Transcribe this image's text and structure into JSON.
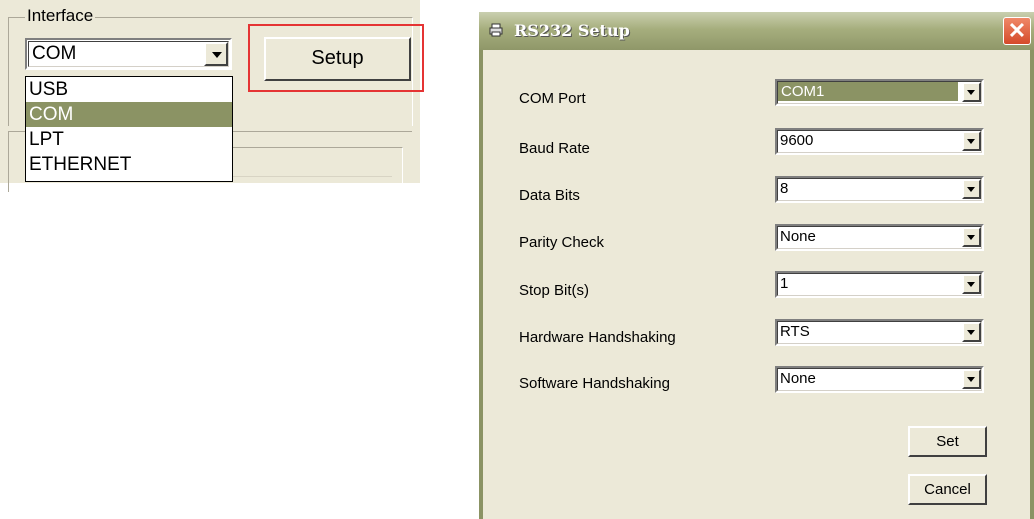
{
  "interface": {
    "group_title": "Interface",
    "combo_value": "COM",
    "options": [
      "USB",
      "COM",
      "LPT",
      "ETHERNET"
    ],
    "selected_option": "COM",
    "setup_label": "Setup",
    "highlight_color": "#e53434"
  },
  "dialog": {
    "title": "RS232 Setup",
    "close_glyph": "✕",
    "rows": [
      {
        "label": "COM Port",
        "value": "COM1"
      },
      {
        "label": "Baud Rate",
        "value": "9600"
      },
      {
        "label": "Data Bits",
        "value": "8"
      },
      {
        "label": "Parity Check",
        "value": "None"
      },
      {
        "label": "Stop Bit(s)",
        "value": "1"
      },
      {
        "label": "Hardware Handshaking",
        "value": "RTS"
      },
      {
        "label": "Software Handshaking",
        "value": "None"
      }
    ],
    "set_label": "Set",
    "cancel_label": "Cancel",
    "accent_color": "#8b9364"
  }
}
